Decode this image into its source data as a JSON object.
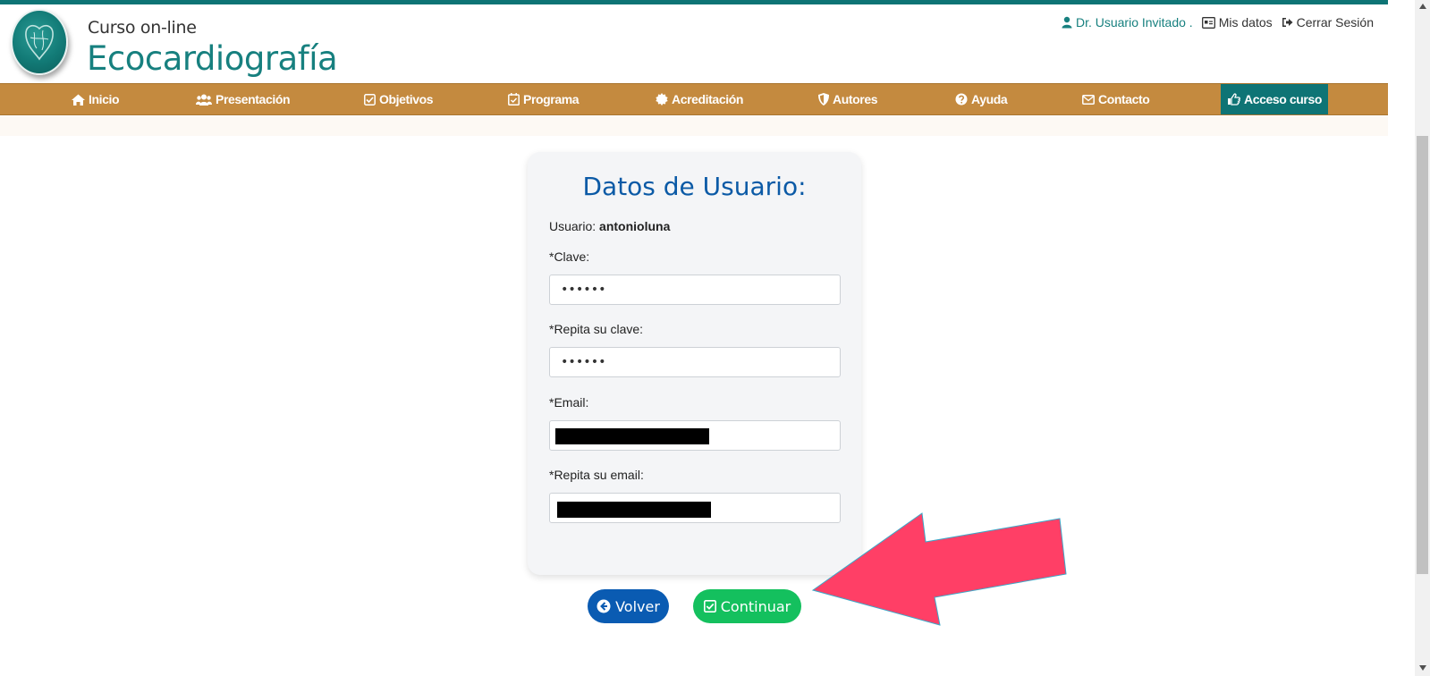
{
  "brand": {
    "small": "Curso  on-line",
    "big": "Ecocardiografía"
  },
  "user_links": {
    "user": "Dr. Usuario Invitado .",
    "mis_datos": "Mis datos",
    "cerrar_sesion": "Cerrar Sesión"
  },
  "nav": {
    "items": [
      {
        "label": "Inicio",
        "icon": "home-icon"
      },
      {
        "label": "Presentación",
        "icon": "users-icon"
      },
      {
        "label": "Objetivos",
        "icon": "check-square-icon"
      },
      {
        "label": "Programa",
        "icon": "calendar-check-icon"
      },
      {
        "label": "Acreditación",
        "icon": "certificate-icon"
      },
      {
        "label": "Autores",
        "icon": "shield-icon"
      },
      {
        "label": "Ayuda",
        "icon": "question-circle-icon"
      },
      {
        "label": "Contacto",
        "icon": "envelope-icon"
      },
      {
        "label": "Acceso curso",
        "icon": "hand-pointer-icon",
        "active": true
      }
    ]
  },
  "form": {
    "title": "Datos de Usuario:",
    "usuario_label": "Usuario:",
    "usuario_value": "antonioluna",
    "clave_label": "*Clave:",
    "clave_value": "••••••",
    "repita_clave_label": "*Repita su clave:",
    "repita_clave_value": "••••••",
    "email_label": "*Email:",
    "repita_email_label": "*Repita su email:"
  },
  "buttons": {
    "volver": "Volver",
    "continuar": "Continuar"
  },
  "colors": {
    "teal": "#0e7475",
    "nav_bg": "#c48a3f",
    "title_blue": "#0b5aa6",
    "btn_blue": "#0a5bb2",
    "btn_green": "#14c05e",
    "arrow_pink": "#ff3f66"
  }
}
